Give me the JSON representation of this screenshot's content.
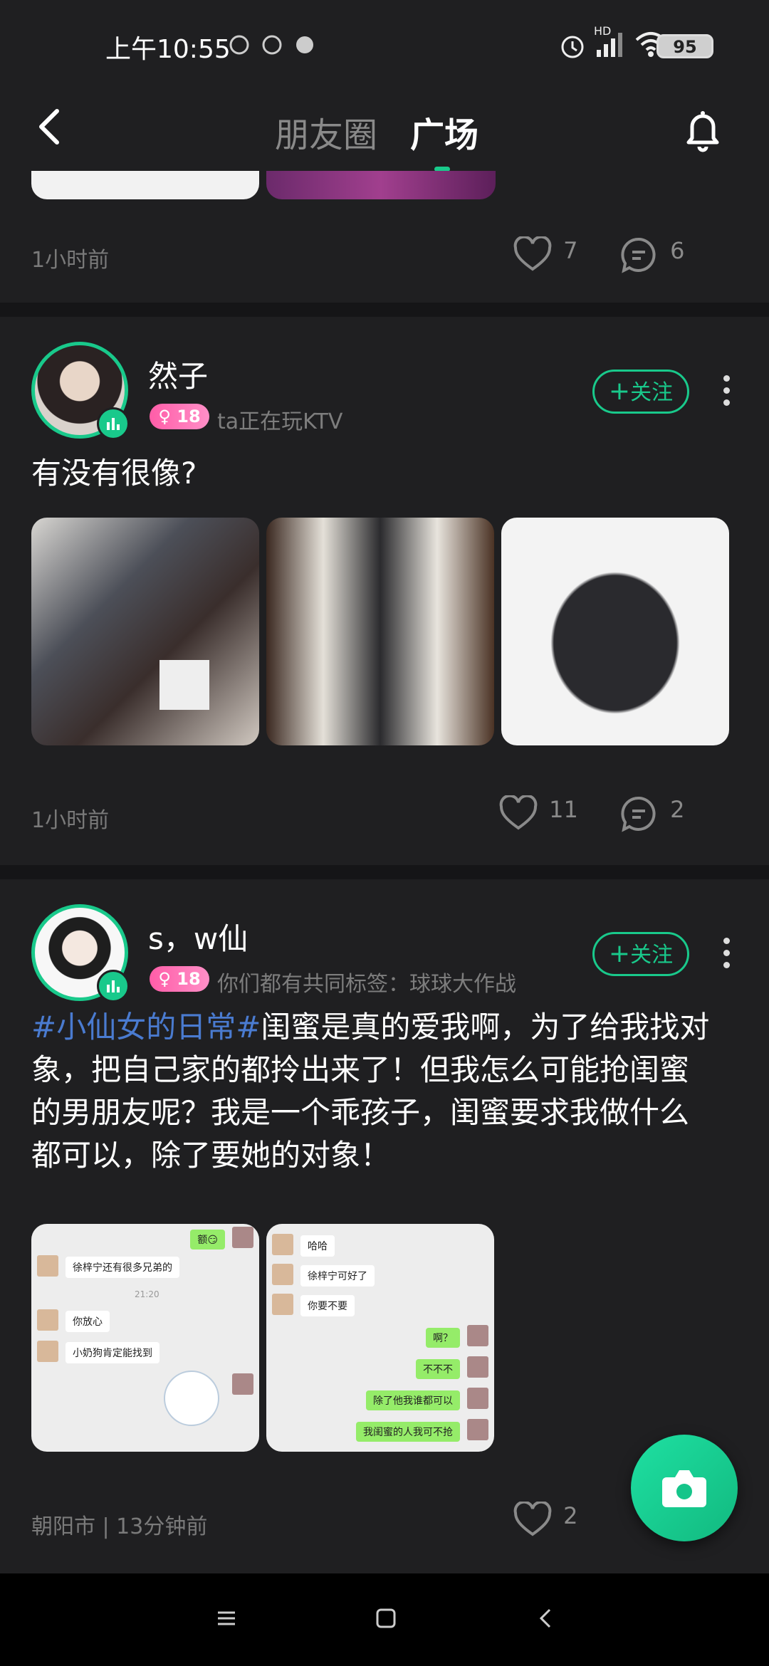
{
  "status_bar": {
    "time": "上午10:55",
    "battery": "95",
    "network": "HD"
  },
  "nav": {
    "tab_friends": "朋友圈",
    "tab_square": "广场"
  },
  "posts": [
    {
      "time": "1小时前",
      "likes": "7",
      "comments": "6"
    },
    {
      "name": "然子",
      "age": "18",
      "subtitle": "ta正在玩KTV",
      "follow": "关注",
      "text": "有没有很像?",
      "time": "1小时前",
      "likes": "11",
      "comments": "2"
    },
    {
      "name": "s，w仙",
      "age": "18",
      "subtitle": "你们都有共同标签：球球大作战",
      "follow": "关注",
      "topic": "#小仙女的日常#",
      "text_lines": [
        "闺蜜是真的爱我啊，为了给我找对",
        "象，把自己家的都拎出来了！但我怎么可能抢闺蜜",
        "的男朋友呢？我是一个乖孩子，闺蜜要求我做什么",
        "都可以，除了要她的对象！"
      ],
      "chat1": {
        "msgs": [
          "额😏",
          "徐梓宁还有很多兄弟的",
          "21:20",
          "你放心",
          "小奶狗肯定能找到"
        ]
      },
      "chat2": {
        "msgs": [
          "哈哈",
          "徐梓宁可好了",
          "你要不要",
          "啊？",
          "不不不",
          "除了他我谁都可以",
          "我闺蜜的人我可不抢"
        ]
      },
      "time": "朝阳市 | 13分钟前",
      "likes": "2"
    }
  ],
  "colors": {
    "accent": "#19c98b",
    "background": "#1f1f21",
    "topic": "#4a7bd0"
  }
}
